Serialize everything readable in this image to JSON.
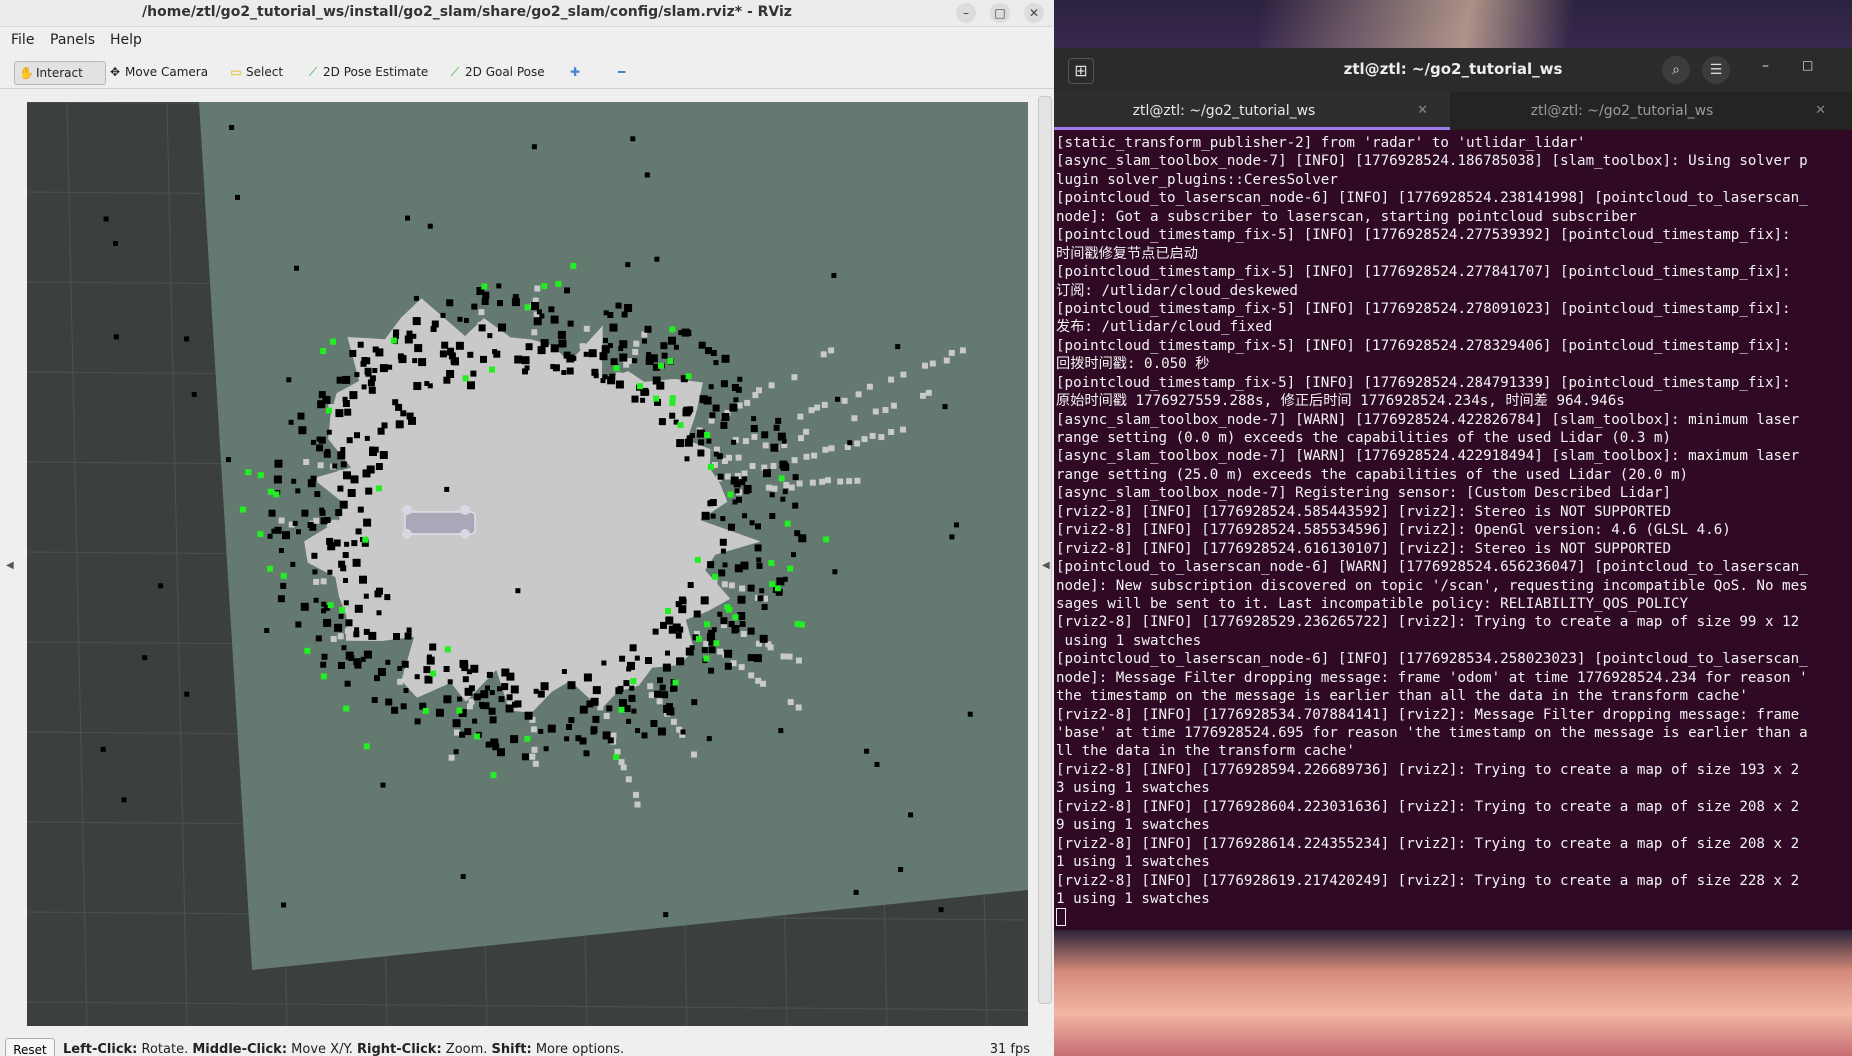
{
  "rviz": {
    "title": "/home/ztl/go2_tutorial_ws/install/go2_slam/share/go2_slam/config/slam.rviz* - RViz",
    "menu": [
      "File",
      "Panels",
      "Help"
    ],
    "toolbar": {
      "interact": "Interact",
      "move_camera": "Move Camera",
      "select": "Select",
      "pose_estimate": "2D Pose Estimate",
      "goal_pose": "2D Goal Pose"
    },
    "status": {
      "reset": "Reset",
      "hint_left_bold": "Left-Click:",
      "hint_left": " Rotate. ",
      "hint_middle_bold": "Middle-Click:",
      "hint_middle": " Move X/Y. ",
      "hint_right_bold": "Right-Click:",
      "hint_right": " Zoom. ",
      "hint_shift_bold": "Shift:",
      "hint_shift": " More options.",
      "fps": "31 fps"
    },
    "colors": {
      "map_free": "#c9c9c9",
      "map_unknown": "#64796f",
      "map_occupied": "#000000",
      "scan_points": "#22ee22",
      "background": "#3b3f3d"
    },
    "icons": [
      "hand-icon",
      "camera-icon",
      "select-icon",
      "pose-arrow-icon",
      "goal-arrow-icon",
      "plus-icon",
      "minus-icon"
    ]
  },
  "terminal": {
    "title": "ztl@ztl: ~/go2_tutorial_ws",
    "tabs": [
      "ztl@ztl: ~/go2_tutorial_ws",
      "ztl@ztl: ~/go2_tutorial_ws"
    ],
    "lines": [
      "[static_transform_publisher-2] from 'radar' to 'utlidar_lidar'",
      "[async_slam_toolbox_node-7] [INFO] [1776928524.186785038] [slam_toolbox]: Using solver p",
      "lugin solver_plugins::CeresSolver",
      "[pointcloud_to_laserscan_node-6] [INFO] [1776928524.238141998] [pointcloud_to_laserscan_",
      "node]: Got a subscriber to laserscan, starting pointcloud subscriber",
      "[pointcloud_timestamp_fix-5] [INFO] [1776928524.277539392] [pointcloud_timestamp_fix]: ",
      "时间戳修复节点已启动",
      "[pointcloud_timestamp_fix-5] [INFO] [1776928524.277841707] [pointcloud_timestamp_fix]: ",
      "订阅: /utlidar/cloud_deskewed",
      "[pointcloud_timestamp_fix-5] [INFO] [1776928524.278091023] [pointcloud_timestamp_fix]: ",
      "发布: /utlidar/cloud_fixed",
      "[pointcloud_timestamp_fix-5] [INFO] [1776928524.278329406] [pointcloud_timestamp_fix]: ",
      "回拨时间戳: 0.050 秒",
      "[pointcloud_timestamp_fix-5] [INFO] [1776928524.284791339] [pointcloud_timestamp_fix]: ",
      "原始时间戳 1776927559.288s, 修正后时间 1776928524.234s, 时间差 964.946s",
      "[async_slam_toolbox_node-7] [WARN] [1776928524.422826784] [slam_toolbox]: minimum laser ",
      "range setting (0.0 m) exceeds the capabilities of the used Lidar (0.3 m)",
      "[async_slam_toolbox_node-7] [WARN] [1776928524.422918494] [slam_toolbox]: maximum laser ",
      "range setting (25.0 m) exceeds the capabilities of the used Lidar (20.0 m)",
      "[async_slam_toolbox_node-7] Registering sensor: [Custom Described Lidar]",
      "[rviz2-8] [INFO] [1776928524.585443592] [rviz2]: Stereo is NOT SUPPORTED",
      "[rviz2-8] [INFO] [1776928524.585534596] [rviz2]: OpenGl version: 4.6 (GLSL 4.6)",
      "[rviz2-8] [INFO] [1776928524.616130107] [rviz2]: Stereo is NOT SUPPORTED",
      "[pointcloud_to_laserscan_node-6] [WARN] [1776928524.656236047] [pointcloud_to_laserscan_",
      "node]: New subscription discovered on topic '/scan', requesting incompatible QoS. No mes",
      "sages will be sent to it. Last incompatible policy: RELIABILITY_QOS_POLICY",
      "[rviz2-8] [INFO] [1776928529.236265722] [rviz2]: Trying to create a map of size 99 x 12",
      " using 1 swatches",
      "[pointcloud_to_laserscan_node-6] [INFO] [1776928534.258023023] [pointcloud_to_laserscan_",
      "node]: Message Filter dropping message: frame 'odom' at time 1776928524.234 for reason '",
      "the timestamp on the message is earlier than all the data in the transform cache'",
      "[rviz2-8] [INFO] [1776928534.707884141] [rviz2]: Message Filter dropping message: frame ",
      "'base' at time 1776928524.695 for reason 'the timestamp on the message is earlier than a",
      "ll the data in the transform cache'",
      "[rviz2-8] [INFO] [1776928594.226689736] [rviz2]: Trying to create a map of size 193 x 2",
      "3 using 1 swatches",
      "[rviz2-8] [INFO] [1776928604.223031636] [rviz2]: Trying to create a map of size 208 x 2",
      "9 using 1 swatches",
      "[rviz2-8] [INFO] [1776928614.224355234] [rviz2]: Trying to create a map of size 208 x 2",
      "1 using 1 swatches",
      "[rviz2-8] [INFO] [1776928619.217420249] [rviz2]: Trying to create a map of size 228 x 2",
      "1 using 1 swatches"
    ]
  }
}
